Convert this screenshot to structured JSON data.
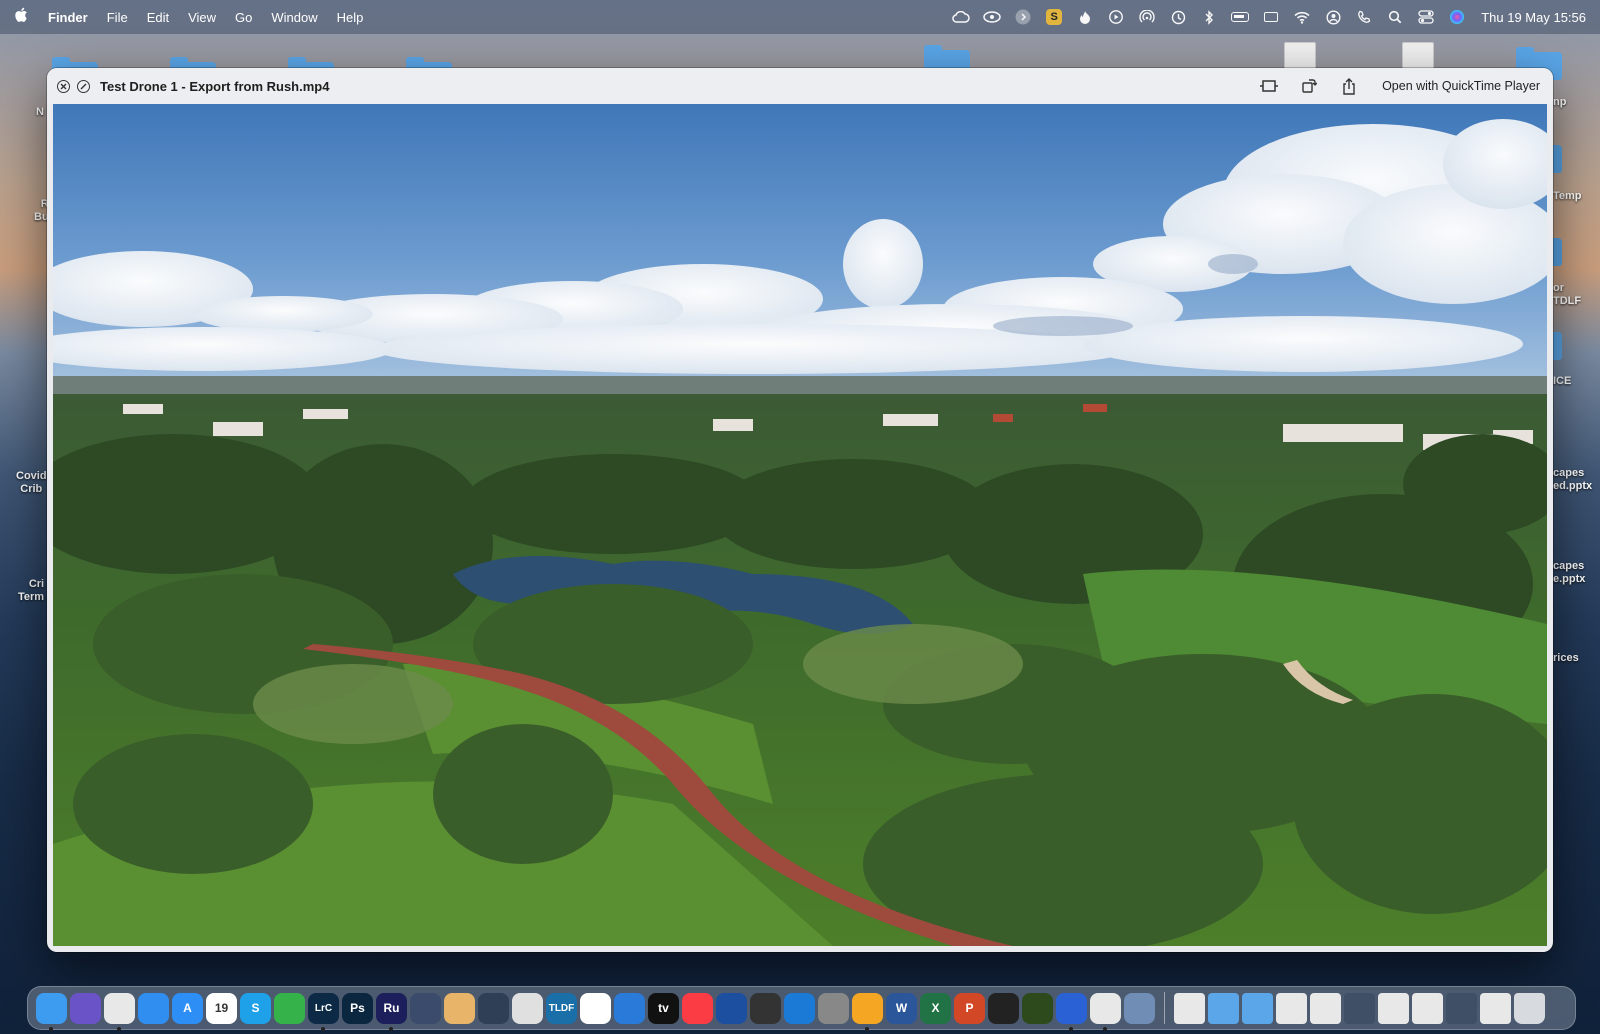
{
  "menubar": {
    "apple_icon": "apple-logo",
    "app_name": "Finder",
    "menus": [
      "File",
      "Edit",
      "View",
      "Go",
      "Window",
      "Help"
    ],
    "status_icons": [
      "creative-cloud-icon",
      "eye-icon",
      "arrow-circle-icon",
      "s-badge-icon",
      "flame-icon",
      "play-icon",
      "airdrop-icon",
      "time-machine-icon",
      "bluetooth-icon",
      "battery-icon",
      "keyboard-icon",
      "wifi-icon",
      "user-icon",
      "phone-icon",
      "search-icon",
      "control-center-icon",
      "siri-icon"
    ],
    "s_badge": "S",
    "clock": "Thu 19 May  15:56"
  },
  "desktop": {
    "labels": [
      {
        "text": "N"
      },
      {
        "text": "R\nBu"
      },
      {
        "text": "Covid\nCrib"
      },
      {
        "text": "Cri\nTerm"
      },
      {
        "text": "np"
      },
      {
        "text": "Temp"
      },
      {
        "text": "or\nTDLF"
      },
      {
        "text": "ICE"
      },
      {
        "text": "capes\ned.pptx"
      },
      {
        "text": "capes\ne.pptx"
      },
      {
        "text": "rices"
      }
    ]
  },
  "quicklook": {
    "title": "Test Drone 1 - Export from Rush.mp4",
    "close_icon": "close-icon",
    "fullscreen_icon": "fullscreen-icon",
    "trim_icon": "trim-icon",
    "rotate_icon": "rotate-icon",
    "share_icon": "share-icon",
    "open_button": "Open with QuickTime Player"
  },
  "dock": {
    "apps": [
      {
        "name": "finder",
        "label": "",
        "color": "#3d9bf0",
        "running": true
      },
      {
        "name": "siri",
        "label": "",
        "color": "#6a52c7",
        "running": false
      },
      {
        "name": "chrome",
        "label": "",
        "color": "#e8e8e8",
        "running": true
      },
      {
        "name": "safari",
        "label": "",
        "color": "#2f8ef0",
        "running": false
      },
      {
        "name": "app-store",
        "label": "A",
        "color": "#2d8ef5",
        "running": false
      },
      {
        "name": "calendar",
        "label": "19",
        "color": "#ffffff",
        "running": false
      },
      {
        "name": "skype",
        "label": "S",
        "color": "#1ea1e8",
        "running": false
      },
      {
        "name": "lock-app",
        "label": "",
        "color": "#35b24a",
        "running": false
      },
      {
        "name": "lightroom-classic",
        "label": "LrC",
        "color": "#0c2a45",
        "running": true
      },
      {
        "name": "photoshop",
        "label": "Ps",
        "color": "#0b2740",
        "running": false
      },
      {
        "name": "premiere-rush",
        "label": "Ru",
        "color": "#1c1f5c",
        "running": true
      },
      {
        "name": "image-app",
        "label": "",
        "color": "#3b4b6b",
        "running": false
      },
      {
        "name": "brush-app",
        "label": "",
        "color": "#e7b46a",
        "running": false
      },
      {
        "name": "image-app-2",
        "label": "",
        "color": "#2f3f56",
        "running": false
      },
      {
        "name": "compass-app",
        "label": "",
        "color": "#e0e0e0",
        "running": false
      },
      {
        "name": "tldf-app",
        "label": "TLDF",
        "color": "#1a6fa8",
        "running": false
      },
      {
        "name": "photos",
        "label": "",
        "color": "#ffffff",
        "running": false
      },
      {
        "name": "search-app",
        "label": "",
        "color": "#2a7ad9",
        "running": false
      },
      {
        "name": "apple-tv",
        "label": "tv",
        "color": "#111111",
        "running": false
      },
      {
        "name": "music",
        "label": "",
        "color": "#fc3c44",
        "running": false
      },
      {
        "name": "waveform-app",
        "label": "",
        "color": "#1c4fa0",
        "running": false
      },
      {
        "name": "unity-app",
        "label": "",
        "color": "#333333",
        "running": false
      },
      {
        "name": "circle-app",
        "label": "",
        "color": "#1b7ad6",
        "running": false
      },
      {
        "name": "system-preferences",
        "label": "",
        "color": "#888888",
        "running": false
      },
      {
        "name": "pencil-app",
        "label": "",
        "color": "#f5a623",
        "running": true
      },
      {
        "name": "word",
        "label": "W",
        "color": "#2b579a",
        "running": false
      },
      {
        "name": "excel",
        "label": "X",
        "color": "#217346",
        "running": false
      },
      {
        "name": "powerpoint",
        "label": "P",
        "color": "#d24726",
        "running": false
      },
      {
        "name": "activity-monitor",
        "label": "",
        "color": "#222222",
        "running": false
      },
      {
        "name": "battery-app",
        "label": "",
        "color": "#2d4a1c",
        "running": false
      },
      {
        "name": "imovie",
        "label": "",
        "color": "#2a62d5",
        "running": true
      },
      {
        "name": "acrobat",
        "label": "",
        "color": "#e8e8e8",
        "running": true
      },
      {
        "name": "preview",
        "label": "",
        "color": "#6f8db5",
        "running": false
      }
    ],
    "stack_items": [
      {
        "name": "doc-stack-1",
        "color": "#e8e8e8"
      },
      {
        "name": "folder-stack-1",
        "color": "#5aa6e8"
      },
      {
        "name": "folder-stack-2",
        "color": "#5aa6e8"
      },
      {
        "name": "doc-stack-2",
        "color": "#e8e8e8"
      },
      {
        "name": "doc-stack-3",
        "color": "#e8e8e8"
      },
      {
        "name": "image-stack-1",
        "color": "#3f4f66"
      },
      {
        "name": "doc-stack-4",
        "color": "#e8e8e8"
      },
      {
        "name": "doc-stack-5",
        "color": "#e8e8e8"
      },
      {
        "name": "image-stack-2",
        "color": "#3f4f66"
      },
      {
        "name": "doc-stack-6",
        "color": "#e8e8e8"
      },
      {
        "name": "trash",
        "color": "#d7dbe0"
      }
    ]
  }
}
